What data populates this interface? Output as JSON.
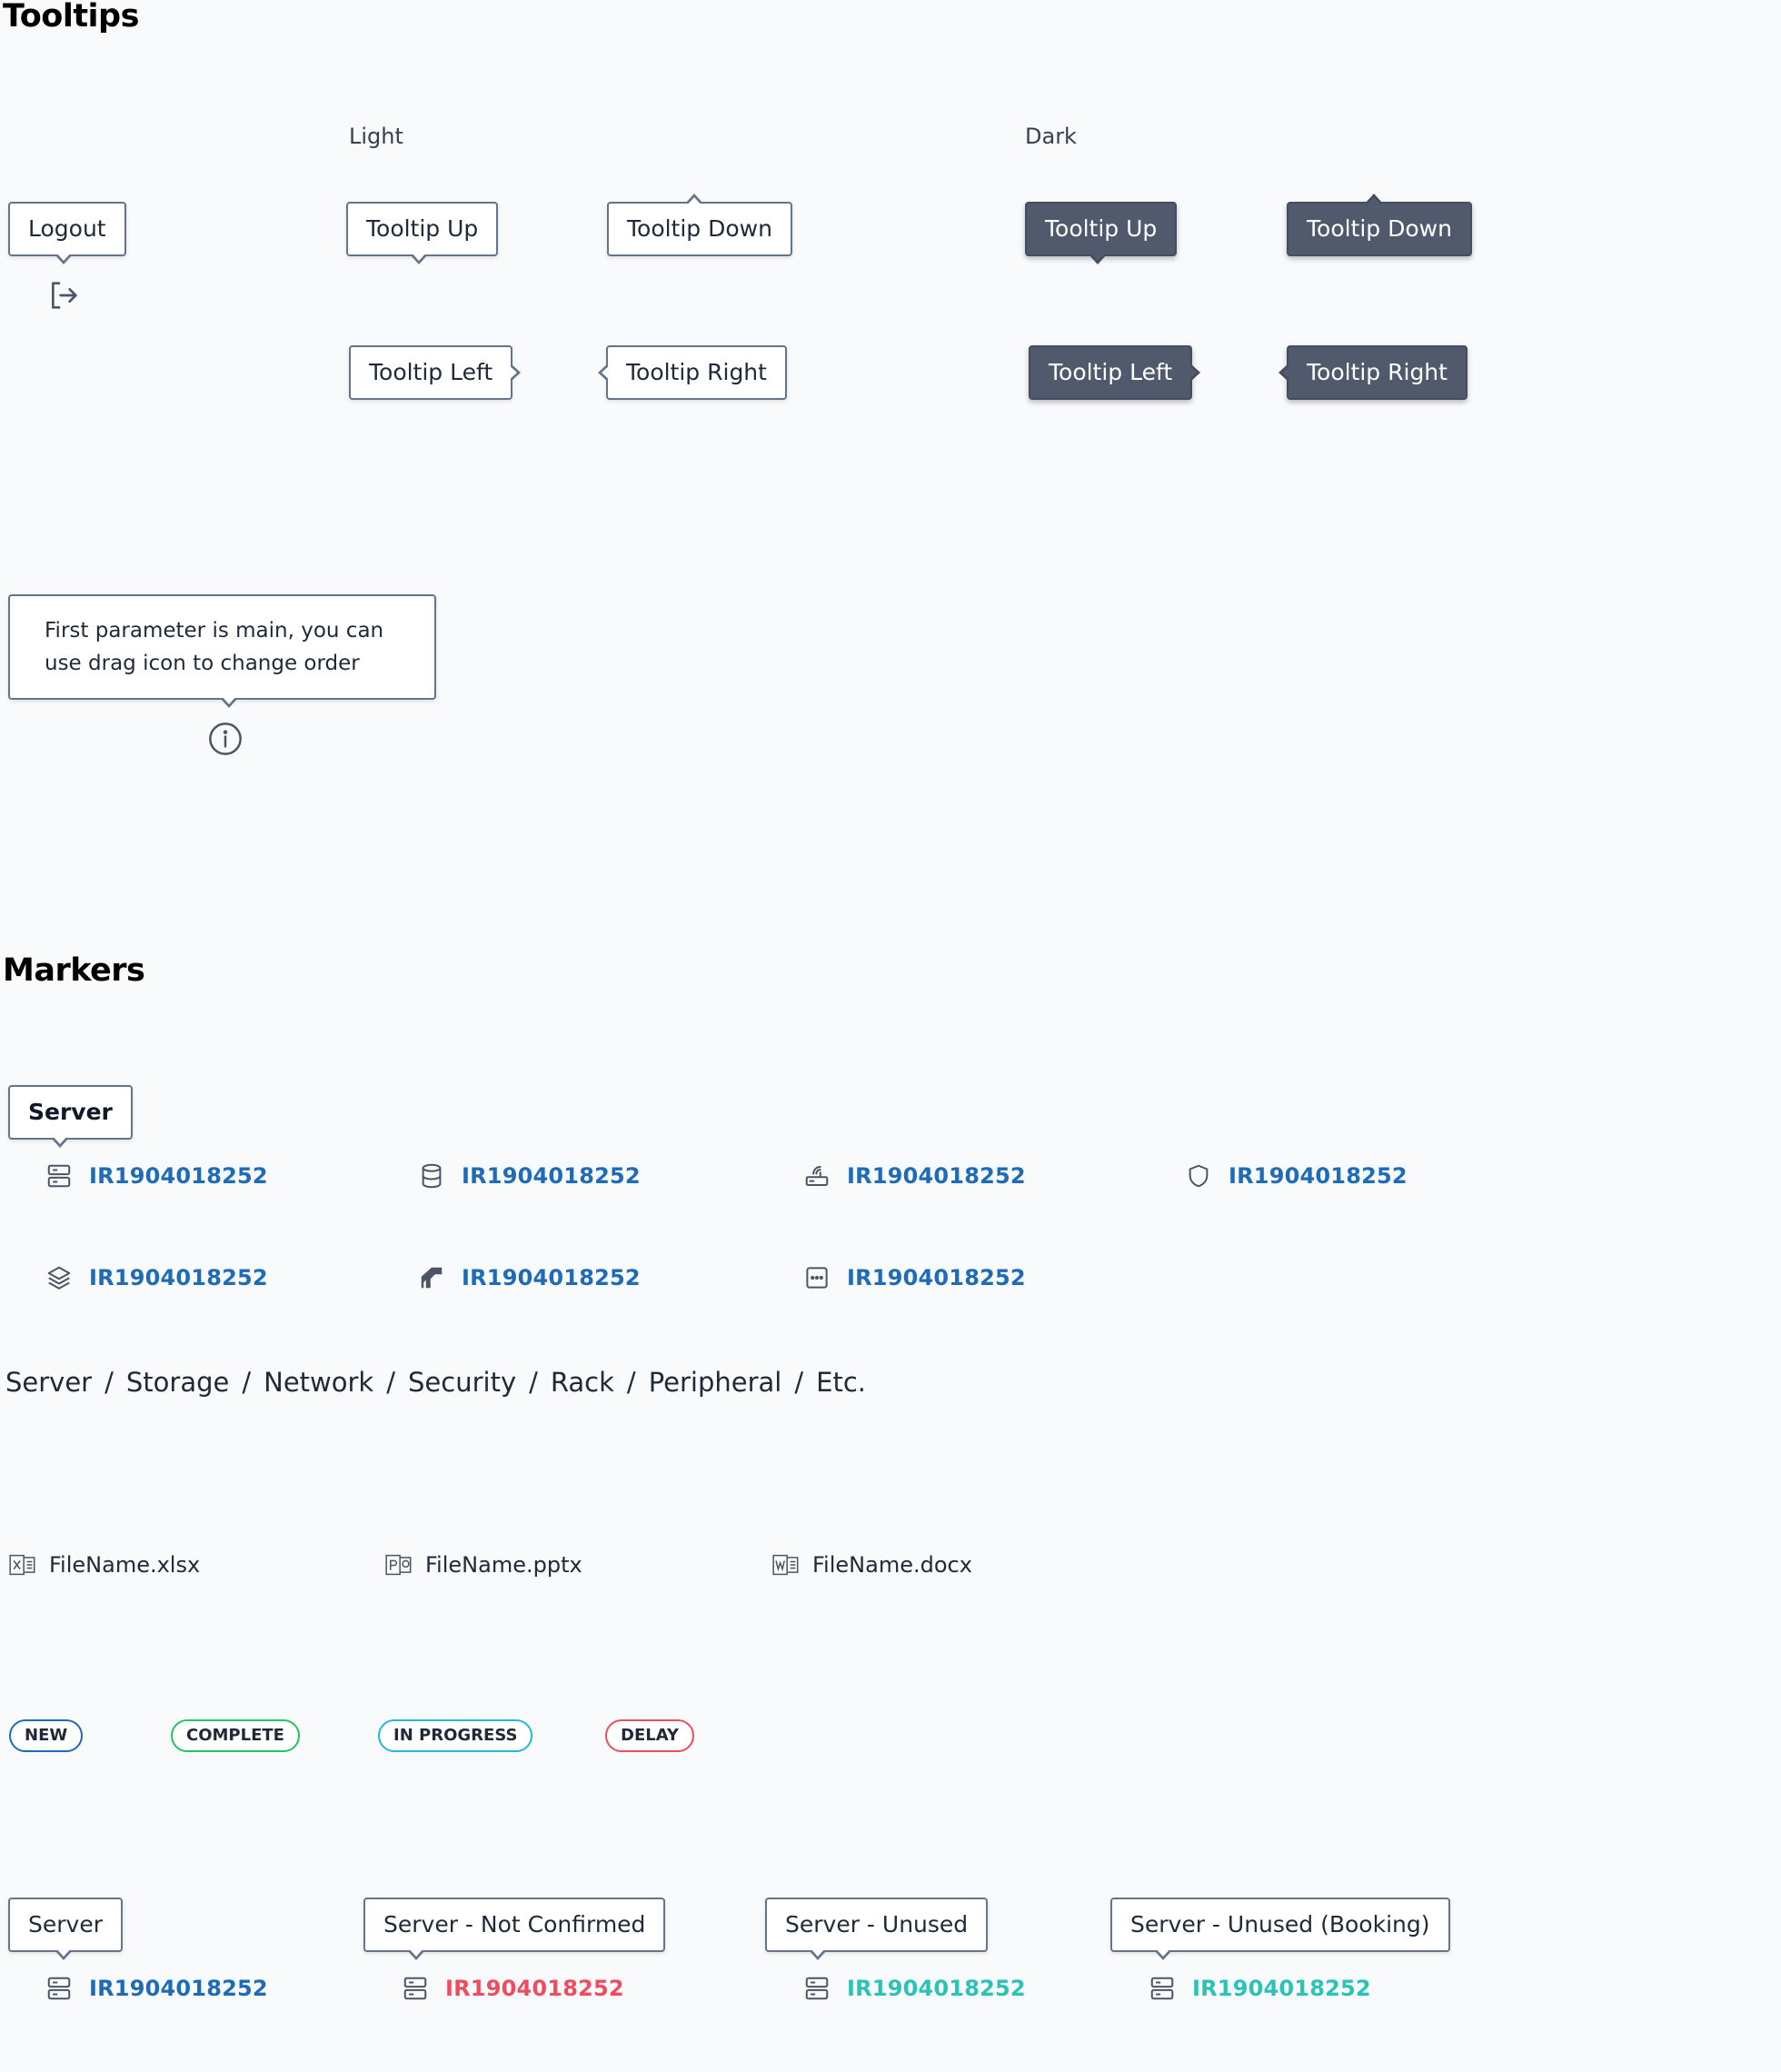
{
  "tooltips": {
    "title": "Tooltips",
    "light_label": "Light",
    "dark_label": "Dark",
    "logout": "Logout",
    "up": "Tooltip Up",
    "down": "Tooltip Down",
    "left": "Tooltip Left",
    "right": "Tooltip Right",
    "info_text": "First parameter is main, you can use drag icon to change order",
    "icons": {
      "logout": "logout-icon",
      "info": "info-icon"
    }
  },
  "markers": {
    "title": "Markers",
    "server_tooltip": "Server",
    "id": "IR1904018252",
    "icons": [
      "server-icon",
      "database-icon",
      "network-icon",
      "shield-icon",
      "layers-icon",
      "rack-icon",
      "etc-icon"
    ],
    "breadcrumb": [
      "Server",
      "Storage",
      "Network",
      "Security",
      "Rack",
      "Peripheral",
      "Etc."
    ],
    "breadcrumb_sep": "/",
    "files": [
      {
        "name": "FileName.xlsx",
        "icon": "excel-file-icon"
      },
      {
        "name": "FileName.pptx",
        "icon": "powerpoint-file-icon"
      },
      {
        "name": "FileName.docx",
        "icon": "word-file-icon"
      }
    ],
    "badges": [
      {
        "label": "NEW",
        "color": "#1e6bb8"
      },
      {
        "label": "COMPLETE",
        "color": "#22c55e"
      },
      {
        "label": "IN PROGRESS",
        "color": "#22b8d6"
      },
      {
        "label": "DELAY",
        "color": "#ef4c5f"
      }
    ],
    "states": [
      {
        "tooltip": "Server",
        "color": "#1e6bb8"
      },
      {
        "tooltip": "Server - Not Confirmed",
        "color": "#ef4c5f"
      },
      {
        "tooltip": "Server - Unused",
        "color": "#2bc3b5"
      },
      {
        "tooltip": "Server - Unused (Booking)",
        "color": "#2bc3b5"
      }
    ]
  }
}
